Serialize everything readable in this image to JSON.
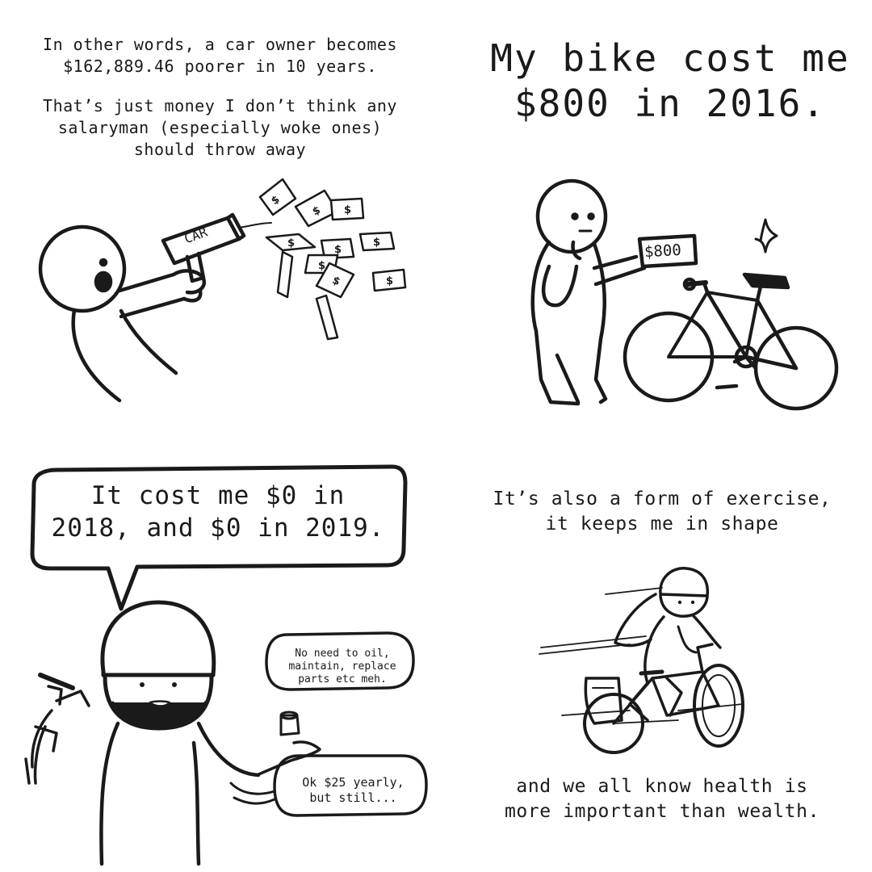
{
  "panels": [
    {
      "id": "panel-1",
      "text_lines": [
        [
          "In other words, a car owner becomes",
          "$162,889.46 poorer in 10 years."
        ],
        [
          "That’s just money I don’t think any",
          "salaryman (especially woke ones)",
          "should throw away"
        ]
      ],
      "money_box_label": "CAR"
    },
    {
      "id": "panel-2",
      "heading_lines": [
        "My bike cost me",
        "$800 in 2016."
      ],
      "price_sign": "$800"
    },
    {
      "id": "panel-3",
      "speech_bubble_lines": [
        "It cost me $0 in",
        "2018, and $0 in 2019."
      ],
      "thought_bubble_1_lines": [
        "No need to oil,",
        "maintain, replace",
        "parts etc meh."
      ],
      "thought_bubble_2_lines": [
        "Ok $25 yearly,",
        "but still..."
      ]
    },
    {
      "id": "panel-4",
      "top_lines": [
        "It’s also a form of exercise,",
        "it keeps me in shape"
      ],
      "bottom_lines": [
        "and we all know health is",
        "more important than wealth."
      ]
    }
  ],
  "ink_color": "#1a1a1a",
  "paper_color": "#ffffff"
}
